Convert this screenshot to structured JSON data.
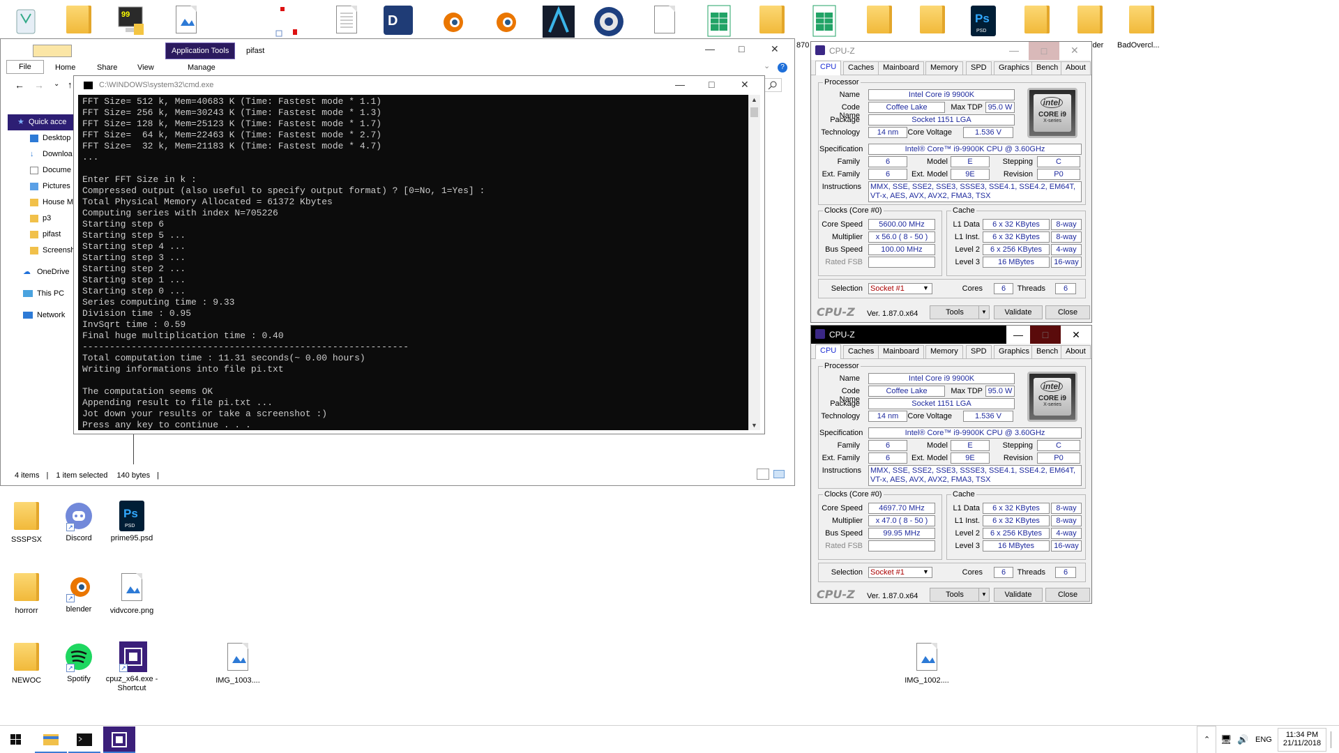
{
  "desktop_top_icons": [
    "recycle-bin",
    "folder",
    "computer-shortcut",
    "image-file",
    "small-image",
    "text-file",
    "app-shortcut",
    "blender",
    "blender",
    "app-shortcut",
    "cinema4d",
    "text-file",
    "spreadsheet",
    "folder",
    "spreadsheet",
    "folder",
    "folder",
    "photoshop-psd",
    "folder",
    "folder",
    "folder"
  ],
  "top_labels": {
    "left_partial": "870",
    "builder": "lder",
    "badoverclock": "BadOvercl..."
  },
  "desktop_icons": [
    {
      "label": "SSSPSX",
      "icon": "folder"
    },
    {
      "label": "Discord",
      "icon": "discord"
    },
    {
      "label": "prime95.psd",
      "icon": "photoshop-psd"
    },
    {
      "label": "horrorr",
      "icon": "folder"
    },
    {
      "label": "blender",
      "icon": "blender"
    },
    {
      "label": "vidvcore.png",
      "icon": "image-file"
    },
    {
      "label": "NEWOC",
      "icon": "folder"
    },
    {
      "label": "Spotify",
      "icon": "spotify"
    },
    {
      "label": "cpuz_x64.exe - Shortcut",
      "icon": "cpuz"
    },
    {
      "label": "IMG_1003....",
      "icon": "image-file"
    },
    {
      "label": "IMG_1002....",
      "icon": "image-file"
    }
  ],
  "explorer": {
    "app_tools": "Application Tools",
    "title": "pifast",
    "tabs": [
      "File",
      "Home",
      "Share",
      "View",
      "Manage"
    ],
    "nav": [
      "Quick acce",
      "Desktop",
      "Downloa",
      "Docume",
      "Pictures",
      "House M",
      "p3",
      "pifast",
      "Screensh",
      "OneDrive",
      "This PC",
      "Network"
    ],
    "status": {
      "items": "4 items",
      "selected": "1 item selected",
      "size": "140 bytes"
    }
  },
  "cmd": {
    "title": "C:\\WINDOWS\\system32\\cmd.exe",
    "output": "FFT Size= 512 k, Mem=40683 K (Time: Fastest mode * 1.1)\nFFT Size= 256 k, Mem=30243 K (Time: Fastest mode * 1.3)\nFFT Size= 128 k, Mem=25123 K (Time: Fastest mode * 1.7)\nFFT Size=  64 k, Mem=22463 K (Time: Fastest mode * 2.7)\nFFT Size=  32 k, Mem=21183 K (Time: Fastest mode * 4.7)\n...\n\nEnter FFT Size in k :\nCompressed output (also useful to specify output format) ? [0=No, 1=Yes] :\nTotal Physical Memory Allocated = 61372 Kbytes\nComputing series with index N=705226\nStarting step 6\nStarting step 5 ...\nStarting step 4 ...\nStarting step 3 ...\nStarting step 2 ...\nStarting step 1 ...\nStarting step 0 ...\nSeries computing time : 9.33\nDivision time : 0.95\nInvSqrt time : 0.59\nFinal huge multiplication time : 0.40\n------------------------------------------------------------\nTotal computation time : 11.31 seconds(~ 0.00 hours)\nWriting informations into file pi.txt\n\nThe computation seems OK\nAppending result to file pi.txt ...\nJot down your results or take a screenshot :)\nPress any key to continue . . ."
  },
  "cpuz_common": {
    "title": "CPU-Z",
    "tabs": [
      "CPU",
      "Caches",
      "Mainboard",
      "Memory",
      "SPD",
      "Graphics",
      "Bench",
      "About"
    ],
    "processor_label": "Processor",
    "labels": {
      "name": "Name",
      "codename": "Code Name",
      "maxtdp": "Max TDP",
      "package": "Package",
      "technology": "Technology",
      "corevoltage": "Core Voltage",
      "specification": "Specification",
      "family": "Family",
      "model": "Model",
      "stepping": "Stepping",
      "extfamily": "Ext. Family",
      "extmodel": "Ext. Model",
      "revision": "Revision",
      "instructions": "Instructions",
      "clocks": "Clocks (Core #0)",
      "corespeed": "Core Speed",
      "multiplier": "Multiplier",
      "busspeed": "Bus Speed",
      "ratedfsb": "Rated FSB",
      "cache": "Cache",
      "l1data": "L1 Data",
      "l1inst": "L1 Inst.",
      "level2": "Level 2",
      "level3": "Level 3",
      "selection": "Selection",
      "cores": "Cores",
      "threads": "Threads"
    },
    "values": {
      "name": "Intel Core i9 9900K",
      "codename": "Coffee Lake",
      "maxtdp": "95.0 W",
      "package": "Socket 1151 LGA",
      "technology": "14 nm",
      "corevoltage": "1.536 V",
      "specification": "Intel® Core™ i9-9900K CPU @ 3.60GHz",
      "family": "6",
      "model": "E",
      "stepping": "C",
      "extfamily": "6",
      "extmodel": "9E",
      "revision": "P0",
      "instructions": "MMX, SSE, SSE2, SSE3, SSSE3, SSE4.1, SSE4.2, EM64T, VT-x, AES, AVX, AVX2, FMA3, TSX",
      "l1data": "6 x 32 KBytes",
      "l1data_way": "8-way",
      "l1inst": "6 x 32 KBytes",
      "l1inst_way": "8-way",
      "level2": "6 x 256 KBytes",
      "level2_way": "4-way",
      "level3": "16 MBytes",
      "level3_way": "16-way",
      "selection": "Socket #1",
      "cores": "6",
      "threads": "6"
    },
    "intel_badge": {
      "brand": "intel",
      "line1": "CORE i9",
      "line2": "X-series"
    },
    "footer": {
      "logo": "CPU-Z",
      "version": "Ver. 1.87.0.x64",
      "tools": "Tools",
      "validate": "Validate",
      "close": "Close"
    }
  },
  "cpuz1": {
    "corespeed": "5600.00 MHz",
    "multiplier": "x 56.0 ( 8 - 50 )",
    "busspeed": "100.00 MHz"
  },
  "cpuz2": {
    "corespeed": "4697.70 MHz",
    "multiplier": "x 47.0 ( 8 - 50 )",
    "busspeed": "99.95 MHz"
  },
  "taskbar": {
    "lang": "ENG",
    "time": "11:34 PM",
    "date": "21/11/2018"
  }
}
